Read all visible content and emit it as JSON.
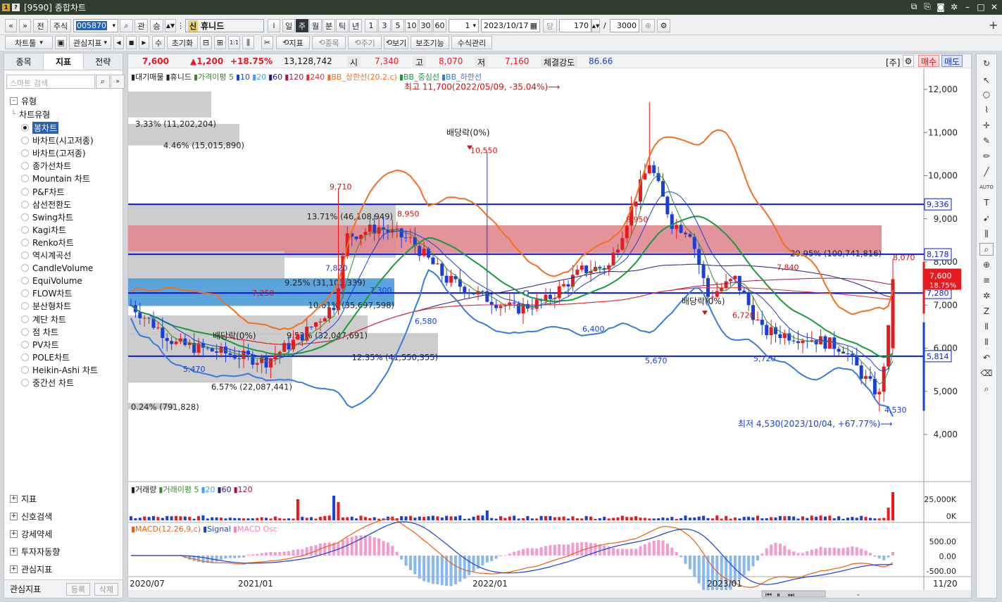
{
  "window": {
    "title_code": "[9590]",
    "title": "종합차트"
  },
  "toolbar1": {
    "btn_prev": "«",
    "btn_up": "»",
    "btn_jeon": "전",
    "market": "주식",
    "code": "005870",
    "btn_search_sym": "⌕",
    "btn_gwan": "관",
    "btn_sang": "승",
    "stock_badge": "신",
    "stock_name": "휴니드",
    "btn_info": "i",
    "periods": [
      "일",
      "주",
      "월",
      "분",
      "틱",
      "년"
    ],
    "active_period": "주",
    "intervals": [
      "1",
      "3",
      "5",
      "10",
      "30",
      "60"
    ],
    "interval_value": "1",
    "date": "2023/10/17",
    "dang": "당",
    "count": "170",
    "slash": "/",
    "total": "3000"
  },
  "toolbar2": {
    "chart_type": "차트툴",
    "interest_indicator": "관심지표",
    "btn_su": "수",
    "btn_reset": "초기화",
    "btn_indicator": "지표",
    "btn_item": "종목",
    "btn_cycle": "주기",
    "btn_view": "보기",
    "btn_aux": "보조기능",
    "btn_formula": "수식관리"
  },
  "left": {
    "tabs": [
      "종목",
      "지표",
      "전략"
    ],
    "active_tab": "지표",
    "search_placeholder": "스마트 검색",
    "group_type": "유형",
    "subgroup": "차트유형",
    "items": [
      "봉차트",
      "바차트(시고저종)",
      "바차트(고저종)",
      "종가선차트",
      "Mountain 차트",
      "P&F차트",
      "삼선전환도",
      "Swing차트",
      "Kagi차트",
      "Renko차트",
      "역시계곡선",
      "CandleVolume",
      "EquiVolume",
      "FLOW차트",
      "분산형차트",
      "계단 차트",
      "점 차트",
      "PV차트",
      "POLE차트",
      "Heikin-Ashi 차트",
      "중간선 차트"
    ],
    "selected_item": "봉차트",
    "groups": [
      "지표",
      "신호검색",
      "강세약세",
      "투자자동향",
      "관심지표"
    ],
    "bottom_label": "관심지표",
    "btn_register": "등록",
    "btn_delete": "삭제"
  },
  "quote": {
    "price": "7,600",
    "change": "▲1,200",
    "rate": "+18.75%",
    "volume": "13,128,742",
    "open_label": "시",
    "open": "7,340",
    "high_label": "고",
    "high": "8,070",
    "low_label": "저",
    "low": "7,160",
    "strength_label": "체결강도",
    "strength": "86.66",
    "jusik": "[주]",
    "buy": "매수",
    "sell": "매도"
  },
  "legend": {
    "main": [
      "대기매물",
      "휴니드",
      "가격이평 5",
      "10",
      "20",
      "60",
      "120",
      "240",
      "BB_상한선(20,2,c)",
      "BB_중심선",
      "BB_하한선"
    ],
    "volume": [
      "거래량",
      "거래이평 5",
      "20",
      "60",
      "120"
    ],
    "macd": [
      "MACD(12,26,9,c)",
      "Signal",
      "MACD Osc"
    ]
  },
  "colors": {
    "up": "#e8191f",
    "down": "#1a3fd8",
    "bb_upper": "#f07020",
    "bb_mid": "#1a9a3a",
    "bb_lower": "#3a7ae0",
    "ma5": "#3b8a2a",
    "ma10": "#1a3fd8",
    "ma20": "#3fa0ff",
    "ma60": "#2a1a80",
    "ma120": "#a01850",
    "ma240": "#e83030",
    "hline": "#0a1ad8",
    "pinkband": "#e08890",
    "blueband": "#4a9ad8"
  },
  "chart_data": {
    "type": "candlestick",
    "title": "휴니드 주봉",
    "y_axis": {
      "min": 4000,
      "max": 12000,
      "ticks": [
        "12,000",
        "11,000",
        "10,000",
        "9,000",
        "8,000",
        "7,000",
        "6,000",
        "5,000",
        "4,000"
      ]
    },
    "x_axis": {
      "ticks": [
        "2020/07",
        "2021/01",
        "2022/01",
        "2023/01",
        "11/20"
      ]
    },
    "hlines": [
      {
        "value": "9,336"
      },
      {
        "value": "8,178"
      },
      {
        "value": "7,280"
      },
      {
        "value": "5,814"
      }
    ],
    "current_price_tag": "7,600",
    "current_rate_tag": "18.75%",
    "annotations": [
      "최고 11,700(2022/05/09, -35.04%)⟶",
      "최저 4,530(2023/10/04, +67.77%)⟶",
      "배당락(0%)",
      "배당락(0%)",
      "배당락(0%)"
    ],
    "peak_labels": [
      "10,550",
      "9,710",
      "8,950",
      "7,840",
      "8,070",
      "7,250",
      "7,820",
      "7,300",
      "6,580",
      "6,400",
      "5,670",
      "5,720",
      "5,470",
      "4,530",
      "8,950",
      "6,720"
    ],
    "volume_profile": [
      {
        "label": "3.33% (11,202,204)"
      },
      {
        "label": "4.46% (15,015,890)"
      },
      {
        "label": "13.71% (46,108,949)"
      },
      {
        "label": "29.95% (100,741,816)"
      },
      {
        "label": "9.25% (31,103,339)"
      },
      {
        "label": "10.61% (35,697,598)"
      },
      {
        "label": "9.53% (32,047,691)"
      },
      {
        "label": "12.35% (41,550,355)"
      },
      {
        "label": "6.57% (22,087,441)"
      },
      {
        "label": "0.24% (791,828)"
      }
    ],
    "volume_axis": [
      "25,000K",
      "0K"
    ],
    "macd_axis": [
      "500.00",
      "0.00",
      "-500.00"
    ]
  },
  "bottom": {
    "zoom": "-"
  }
}
